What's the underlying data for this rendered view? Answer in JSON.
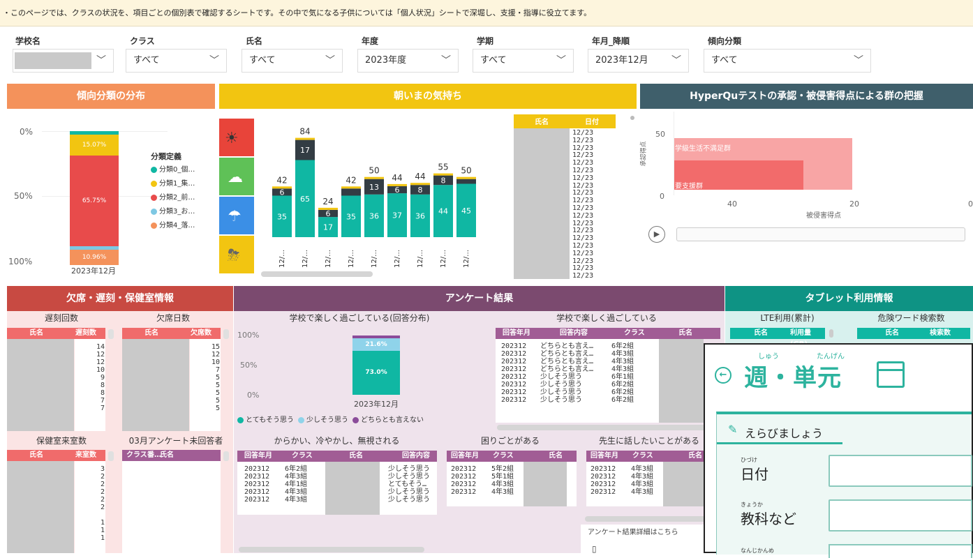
{
  "notice": "・このページでは、クラスの状況を、項目ごとの個別表で確認するシートです。その中で気になる子供については「個人状況」シートで深堀し、支援・指導に役立てます。",
  "filters": [
    {
      "label": "学校名",
      "value": ""
    },
    {
      "label": "クラス",
      "value": "すべて"
    },
    {
      "label": "氏名",
      "value": "すべて"
    },
    {
      "label": "年度",
      "value": "2023年度"
    },
    {
      "label": "学期",
      "value": "すべて"
    },
    {
      "label": "年月_降順",
      "value": "2023年12月"
    },
    {
      "label": "傾向分類",
      "value": "すべて"
    }
  ],
  "sections": {
    "dist": "傾向分類の分布",
    "mood": "朝いまの気持ち",
    "hyperqu": "HyperQuテストの承認・被侵害得点による群の把握",
    "absence": "欠席・遅刻・保健室情報",
    "survey": "アンケート結果",
    "tablet": "タブレット利用情報"
  },
  "colors": {
    "orange": "#f4925b",
    "yellow": "#f2c511",
    "slate": "#3f5f6b",
    "red": "#c84a42",
    "purple": "#7b4a6f",
    "teal": "#0e9384",
    "bar_teal": "#10b7a3",
    "bar_dark": "#333d44",
    "pink_bg": "#fbe4e4",
    "lavender_bg": "#efe3ec",
    "mint_bg": "#d8f1ee"
  },
  "dist_chart": {
    "yticks": [
      "0%",
      "50%",
      "100%"
    ],
    "xlabel": "2023年12月",
    "segments": [
      {
        "name": "分類0_個…",
        "value": 2.5,
        "color": "#10b7a3"
      },
      {
        "name": "分類1_集…",
        "value": 15.07,
        "color": "#f2c511",
        "label": "15.07%"
      },
      {
        "name": "分類2_前…",
        "value": 65.75,
        "color": "#e84b4b",
        "label": "65.75%"
      },
      {
        "name": "分類3_お…",
        "value": 2.5,
        "color": "#7ec8e3"
      },
      {
        "name": "分類4_落…",
        "value": 10.96,
        "color": "#f4925b",
        "label": "10.96%"
      }
    ],
    "legend_title": "分類定義"
  },
  "chart_data": {
    "type": "bar",
    "categories": [
      "12/…",
      "12/…",
      "12/…",
      "12/…",
      "12/…",
      "12/…",
      "12/…",
      "12/…",
      "12/…"
    ],
    "series": [
      {
        "name": "bottom",
        "values": [
          35,
          65,
          17,
          35,
          36,
          37,
          36,
          44,
          45
        ]
      },
      {
        "name": "top",
        "values": [
          6,
          17,
          6,
          6,
          13,
          6,
          8,
          8,
          4
        ]
      }
    ],
    "totals": [
      42,
      84,
      24,
      42,
      50,
      44,
      44,
      55,
      50
    ],
    "segment_labels": [
      [
        "35",
        "6"
      ],
      [
        "65",
        "17"
      ],
      [
        "17",
        "6"
      ],
      [
        "35",
        ""
      ],
      [
        "36",
        "13"
      ],
      [
        "37",
        "6"
      ],
      [
        "36",
        "8"
      ],
      [
        "44",
        "8"
      ],
      [
        "45",
        ""
      ]
    ]
  },
  "mood_table": {
    "col1": "氏名",
    "col2": "日付",
    "values": [
      "12/23",
      "12/23",
      "12/23",
      "12/23",
      "12/23",
      "12/23",
      "12/23",
      "12/23",
      "12/23",
      "12/23",
      "12/23",
      "12/23",
      "12/23",
      "12/23",
      "12/23",
      "12/23",
      "12/23",
      "12/23",
      "12/23",
      "12/23"
    ]
  },
  "hyperqu": {
    "ylabel": "承認得点",
    "xlabel": "被侵害得点",
    "yticks": [
      "50",
      "0"
    ],
    "xticks": [
      "40",
      "20",
      "0"
    ],
    "zone1": "学級生活不満足群",
    "zone2": "要支援群"
  },
  "late": {
    "title": "遅刻回数",
    "c1": "氏名",
    "c2": "遅刻数",
    "values": [
      "14",
      "12",
      "12",
      "10",
      "9",
      "8",
      "8",
      "7",
      "7"
    ]
  },
  "absent": {
    "title": "欠席日数",
    "c1": "氏名",
    "c2": "欠席数",
    "values": [
      "15",
      "12",
      "10",
      "7",
      "5",
      "5",
      "5",
      "5",
      "5"
    ]
  },
  "nurse": {
    "title": "保健室来室数",
    "c1": "氏名",
    "c2": "来室数",
    "values": [
      "3",
      "2",
      "2",
      "2",
      "2",
      "2",
      "",
      "1",
      "1",
      "1"
    ]
  },
  "unanswered": {
    "title": "03月アンケート未回答者",
    "c1": "クラス",
    "c2": "番…",
    "c3": "氏名"
  },
  "survey_dist": {
    "title": "学校で楽しく過ごしている(回答分布)",
    "yticks": [
      "100%",
      "50%",
      "0%"
    ],
    "xlabel": "2023年12月",
    "seg_a": "21.6%",
    "seg_b": "73.0%",
    "legend": [
      {
        "name": "とてもそう思う",
        "color": "#10b7a3"
      },
      {
        "name": "少しそう思う",
        "color": "#8fd3ea"
      },
      {
        "name": "どちらとも言えない",
        "color": "#8b4c9a"
      }
    ]
  },
  "survey_table": {
    "title": "学校で楽しく過ごしている",
    "cols": [
      "回答年月",
      "回答内容",
      "クラス",
      "氏名"
    ],
    "rows": [
      [
        "202312",
        "どちらとも言え…",
        "6年2組"
      ],
      [
        "202312",
        "どちらとも言え…",
        "4年3組"
      ],
      [
        "202312",
        "どちらとも言え…",
        "4年3組"
      ],
      [
        "202312",
        "どちらとも言え…",
        "4年3組"
      ],
      [
        "202312",
        "少しそう思う",
        "6年1組"
      ],
      [
        "202312",
        "少しそう思う",
        "6年2組"
      ],
      [
        "202312",
        "少しそう思う",
        "6年2組"
      ],
      [
        "202312",
        "少しそう思う",
        "6年2組"
      ]
    ]
  },
  "tease": {
    "title": "からかい、冷やかし、無視される",
    "cols": [
      "回答年月",
      "クラス",
      "氏名",
      "回答内容"
    ],
    "rows": [
      [
        "202312",
        "6年2組",
        "少しそう思う"
      ],
      [
        "202312",
        "4年3組",
        "少しそう思う"
      ],
      [
        "202312",
        "4年1組",
        "とてもそう…"
      ],
      [
        "202312",
        "4年3組",
        "少しそう思う"
      ],
      [
        "202312",
        "4年3組",
        "少しそう思う"
      ]
    ]
  },
  "trouble": {
    "title": "困りごとがある",
    "cols": [
      "回答年月",
      "クラス",
      "氏名"
    ],
    "rows": [
      [
        "202312",
        "5年2組"
      ],
      [
        "202312",
        "5年1組"
      ],
      [
        "202312",
        "4年3組"
      ],
      [
        "202312",
        "4年3組"
      ]
    ]
  },
  "teacher": {
    "title": "先生に話したいことがある",
    "cols": [
      "回答年月",
      "クラス",
      "氏名"
    ],
    "rows": [
      [
        "202312",
        "4年3組"
      ],
      [
        "202312",
        "4年3組"
      ],
      [
        "202312",
        "4年3組"
      ],
      [
        "202312",
        "4年3組"
      ]
    ]
  },
  "survey_detail": "アンケート結果詳細はこちら",
  "lte": {
    "title": "LTE利用(累計)",
    "c1": "氏名",
    "c2": "利用量(GB)"
  },
  "danger": {
    "title": "危険ワード検索数",
    "c1": "氏名",
    "c2": "検索数"
  },
  "overlay": {
    "ruby1": "しゅう",
    "ruby2": "たんげん",
    "title": "週・単元",
    "back": "←",
    "choose": "えらびましょう",
    "f1_ruby": "ひづけ",
    "f1": "日付",
    "f2_ruby": "きょうか",
    "f2": "教科など",
    "f3_ruby": "なんじかんめ"
  }
}
